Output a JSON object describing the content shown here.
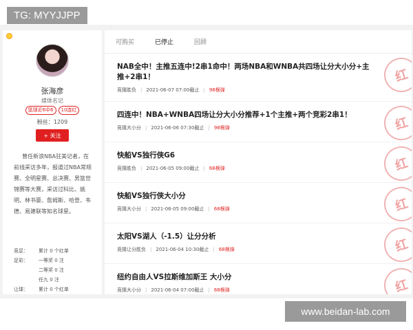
{
  "watermark": {
    "top_left": "TG: MYYJJPP",
    "bottom_right": "www.beidan-lab.com"
  },
  "profile": {
    "name": "张海彦",
    "role": "媒体名记",
    "badges": [
      "篮球近6中6",
      "10连红"
    ],
    "fans_label": "粉丝：",
    "fans_count": "1209",
    "follow_label": "+ 关注",
    "bio": "曾任新浪NBA驻美记者，在前线采访多年，报道过NBA常规赛、全明星赛、总决赛、男篮世锦赛等大赛，采访过科比、姚明、林书豪、詹姆斯、哈登、韦德、易建联等知名球星。"
  },
  "stats": [
    {
      "label": "竞足：",
      "value": "累计 0 个红单"
    },
    {
      "label": "足彩：",
      "value": "一等奖 0 注"
    },
    {
      "label": "",
      "value": "二等奖 0 注"
    },
    {
      "label": "",
      "value": "任九 0 注"
    },
    {
      "label": "让球：",
      "value": "累计 0 个红单"
    }
  ],
  "tabs": [
    {
      "label": "可购买",
      "active": false
    },
    {
      "label": "已停止",
      "active": true
    },
    {
      "label": "回顾",
      "active": false
    }
  ],
  "items": [
    {
      "title": "NAB全中！主推五连中!2串1命中！两场NBA和WNBA共四场让分大小分+主推+2串1！",
      "category": "竞猜胜负",
      "deadline": "2021-06-07 07:00截止",
      "price": "98根弹",
      "stamp": "红"
    },
    {
      "title": "四连中！NBA+WNBA四场让分大小分推荐+1个主推+两个竞彩2串1！",
      "category": "竞猜大小分",
      "deadline": "2021-06-06 07:30截止",
      "price": "98根弹",
      "stamp": "红"
    },
    {
      "title": "快船VS独行侠G6",
      "category": "竞猜胜负",
      "deadline": "2021-06-05 09:00截止",
      "price": "68根弹",
      "stamp": "红"
    },
    {
      "title": "快船VS独行侠大小分",
      "category": "竞猜大小分",
      "deadline": "2021-06-05 09:00截止",
      "price": "68根弹",
      "stamp": "红"
    },
    {
      "title": "太阳VS湖人（-1.5）让分分析",
      "category": "竞猜让分胜负",
      "deadline": "2021-06-04 10:30截止",
      "price": "68根弹",
      "stamp": "红"
    },
    {
      "title": "纽约自由人VS拉斯维加斯王 大小分",
      "category": "竞猜大小分",
      "deadline": "2021-06-04 07:00截止",
      "price": "68根弹",
      "stamp": "红"
    }
  ]
}
